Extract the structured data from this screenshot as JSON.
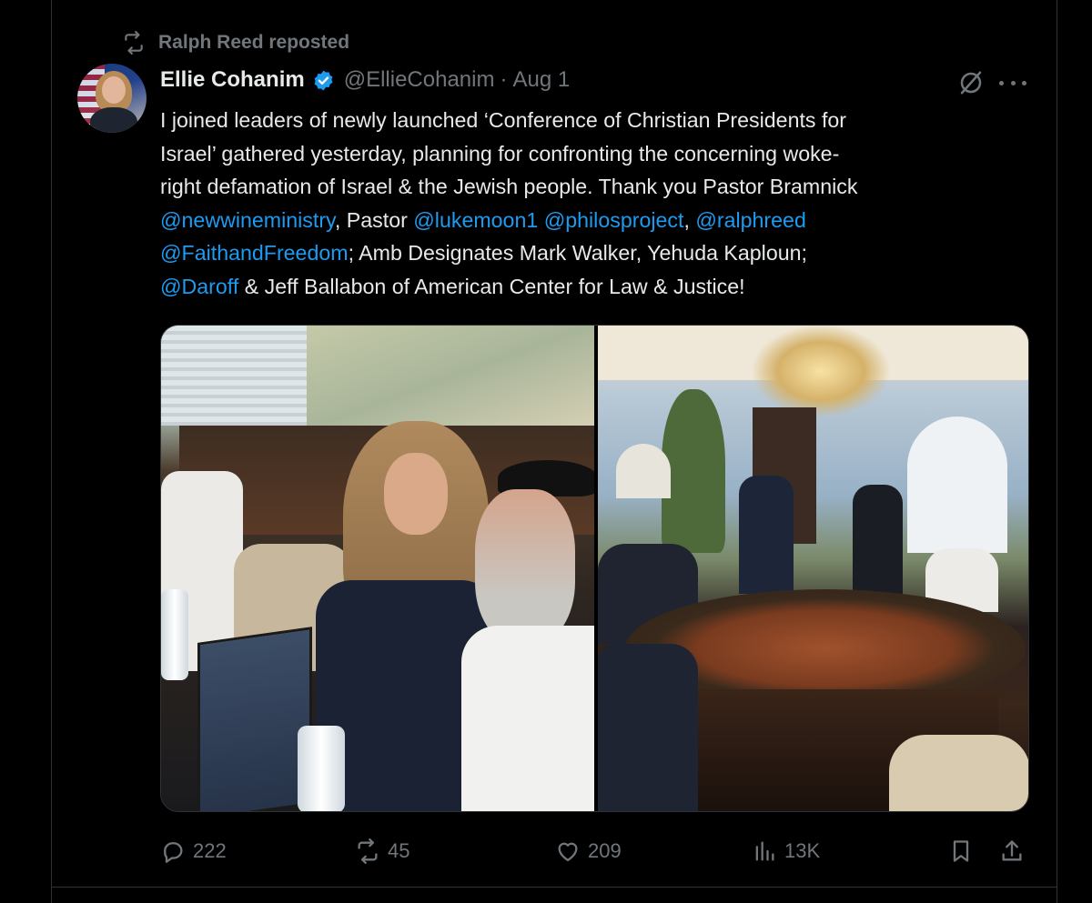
{
  "repost": {
    "text": "Ralph Reed reposted",
    "icon": "repost-icon"
  },
  "author": {
    "name": "Ellie Cohanim",
    "handle": "@EllieCohanim",
    "separator": "·",
    "date": "Aug 1",
    "verified": true,
    "verified_color": "#1d9bf0"
  },
  "tweet": {
    "line1": "I joined leaders of newly launched ‘Conference of Christian Presidents for",
    "line2": "Israel’ gathered yesterday, planning for confronting the concerning woke-",
    "line3": "right defamation of Israel & the Jewish people. Thank you Pastor Bramnick",
    "mention_newwine": "@newwineministry",
    "text_pastor": ", Pastor ",
    "mention_lukemoon": "@lukemoon1",
    "mention_philos": "@philosproject",
    "text_comma": ", ",
    "mention_ralphreed": "@ralphreed",
    "mention_faith": "@FaithandFreedom",
    "text_amb": "; Amb Designates Mark Walker, Yehuda Kaploun;",
    "mention_daroff": "@Daroff",
    "text_end": " & Jeff Ballabon of American Center for Law & Justice!"
  },
  "stats": {
    "replies": "222",
    "reposts": "45",
    "likes": "209",
    "views": "13K"
  },
  "colors": {
    "background": "#000000",
    "text": "#e7e9ea",
    "muted": "#71767b",
    "link": "#1d9bf0",
    "border": "#2f3336"
  }
}
